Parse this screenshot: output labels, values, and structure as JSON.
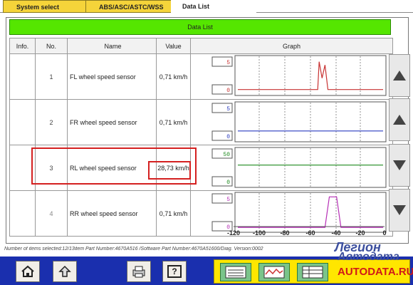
{
  "tabs": [
    {
      "label": "System select"
    },
    {
      "label": "ABS/ASC/ASTC/WSS"
    },
    {
      "label": "Data List"
    }
  ],
  "header": {
    "title": "Data List"
  },
  "columns": {
    "info": "Info.",
    "no": "No.",
    "name": "Name",
    "value": "Value",
    "graph": "Graph"
  },
  "rows": [
    {
      "no": "1",
      "name": "FL wheel speed sensor",
      "value": "0,71 km/h",
      "ymax": "5",
      "ymin": "0",
      "color": "#c83232"
    },
    {
      "no": "2",
      "name": "FR wheel speed sensor",
      "value": "0,71 km/h",
      "ymax": "5",
      "ymin": "0",
      "color": "#2a3bbf"
    },
    {
      "no": "3",
      "name": "RL wheel speed sensor",
      "value": "28,73 km/h",
      "ymax": "50",
      "ymin": "0",
      "color": "#1e8a1e"
    },
    {
      "no": "4",
      "name": "RR wheel speed sensor",
      "value": "0,71 km/h",
      "ymax": "5",
      "ymin": "0",
      "color": "#b62fb6"
    }
  ],
  "xaxis": {
    "ticks": [
      "-120",
      "-100",
      "-80",
      "-60",
      "-40",
      "-20",
      "0"
    ]
  },
  "status": "Number of items selected:12/13item   Part Number:4670A516   /Software Part Number:4670A51600/Diag. Version:0002",
  "watermark": {
    "line1": "Легион",
    "line2": "Автодата",
    "line3": "AUTODATA.RU"
  },
  "bottom": {
    "home_icon": "home-icon",
    "back_icon": "back-arrow-icon",
    "print_icon": "print-icon",
    "help_label": "?"
  }
}
